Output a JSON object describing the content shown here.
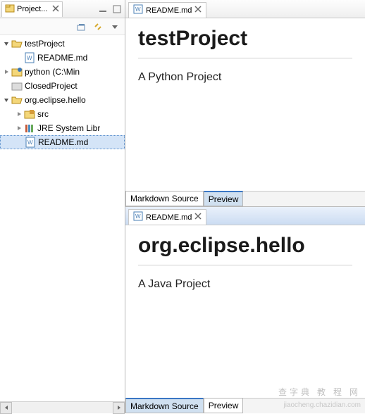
{
  "explorer": {
    "view_title": "Project...",
    "tree": [
      {
        "label": "testProject",
        "icon": "folder-open-icon",
        "indent": 0,
        "twisty": "expanded"
      },
      {
        "label": "README.md",
        "icon": "md-file-icon",
        "indent": 1,
        "twisty": "none"
      },
      {
        "label": "python  (C:\\Min",
        "icon": "python-project-icon",
        "indent": 0,
        "twisty": "collapsed"
      },
      {
        "label": "ClosedProject",
        "icon": "closed-project-icon",
        "indent": 0,
        "twisty": "none"
      },
      {
        "label": "org.eclipse.hello",
        "icon": "java-project-icon",
        "indent": 0,
        "twisty": "expanded"
      },
      {
        "label": "src",
        "icon": "src-folder-icon",
        "indent": 1,
        "twisty": "collapsed"
      },
      {
        "label": "JRE System Libr",
        "icon": "jre-library-icon",
        "indent": 1,
        "twisty": "collapsed"
      },
      {
        "label": "README.md",
        "icon": "md-file-icon",
        "indent": 1,
        "twisty": "none",
        "selected": true
      }
    ]
  },
  "editors": [
    {
      "tab_label": "README.md",
      "content_heading": "testProject",
      "content_text": "A Python Project",
      "bottom_tabs": {
        "source": "Markdown Source",
        "preview": "Preview",
        "active": "preview"
      }
    },
    {
      "tab_label": "README.md",
      "content_heading": "org.eclipse.hello",
      "content_text": "A Java Project",
      "bottom_tabs": {
        "source": "Markdown Source",
        "preview": "Preview",
        "active": "source"
      }
    }
  ],
  "watermark": {
    "main": "查字典 教 程 网",
    "sub": "jiaocheng.chazidian.com"
  }
}
